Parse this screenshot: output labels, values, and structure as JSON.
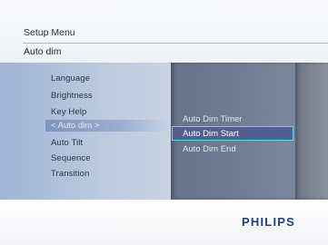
{
  "header": {
    "title": "Setup Menu",
    "breadcrumb": "Auto dim"
  },
  "left_menu": {
    "items": [
      {
        "label": "Language"
      },
      {
        "label": "Brightness"
      },
      {
        "label": "Key Help"
      },
      {
        "label": "< Auto dim >",
        "selected": true
      },
      {
        "label": "Auto Tilt"
      },
      {
        "label": "Sequence"
      },
      {
        "label": "Transition"
      }
    ]
  },
  "submenu": {
    "items": [
      {
        "label": "Auto Dim Timer"
      },
      {
        "label": "Auto Dim Start",
        "focused": true
      },
      {
        "label": "Auto Dim End"
      }
    ]
  },
  "footer": {
    "brand": "PHILIPS"
  },
  "colors": {
    "focus_border": "#6fd0e1",
    "brand": "#1f3c86"
  }
}
